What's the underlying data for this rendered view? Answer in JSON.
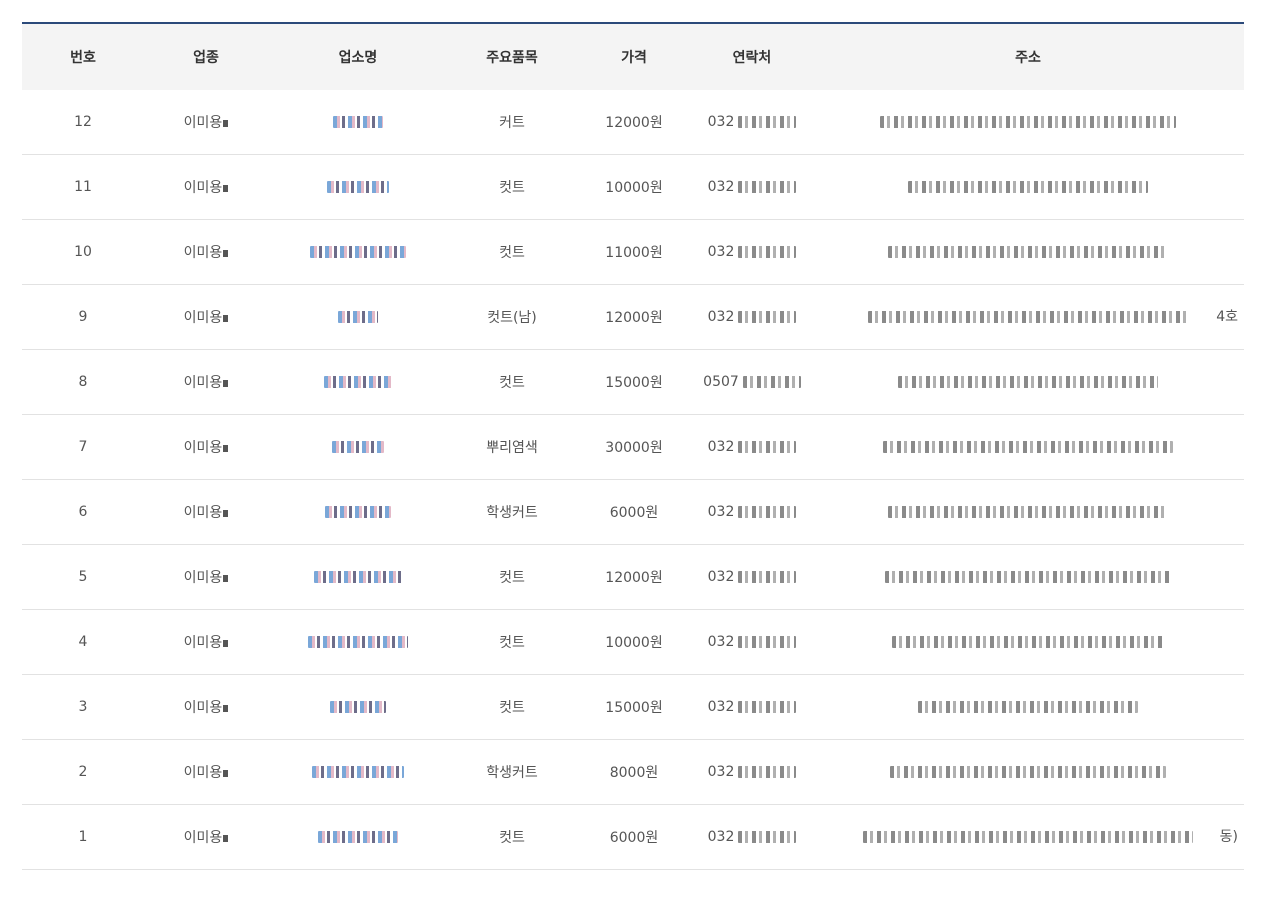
{
  "table": {
    "headers": [
      "번호",
      "업종",
      "업소명",
      "주요품목",
      "가격",
      "연락처",
      "주소"
    ],
    "rows": [
      {
        "num": "12",
        "type": "이미용",
        "item": "커트",
        "price": "12000원",
        "tel": "032",
        "addr_tail": ""
      },
      {
        "num": "11",
        "type": "이미용",
        "item": "컷트",
        "price": "10000원",
        "tel": "032",
        "addr_tail": ""
      },
      {
        "num": "10",
        "type": "이미용",
        "item": "컷트",
        "price": "11000원",
        "tel": "032",
        "addr_tail": ""
      },
      {
        "num": "9",
        "type": "이미용",
        "item": "컷트(남)",
        "price": "12000원",
        "tel": "032",
        "addr_tail": "4호"
      },
      {
        "num": "8",
        "type": "이미용",
        "item": "컷트",
        "price": "15000원",
        "tel": "0507",
        "addr_tail": ""
      },
      {
        "num": "7",
        "type": "이미용",
        "item": "뿌리염색",
        "price": "30000원",
        "tel": "032",
        "addr_tail": ""
      },
      {
        "num": "6",
        "type": "이미용",
        "item": "학생커트",
        "price": "6000원",
        "tel": "032",
        "addr_tail": ""
      },
      {
        "num": "5",
        "type": "이미용",
        "item": "컷트",
        "price": "12000원",
        "tel": "032",
        "addr_tail": ""
      },
      {
        "num": "4",
        "type": "이미용",
        "item": "컷트",
        "price": "10000원",
        "tel": "032",
        "addr_tail": ""
      },
      {
        "num": "3",
        "type": "이미용",
        "item": "컷트",
        "price": "15000원",
        "tel": "032",
        "addr_tail": ""
      },
      {
        "num": "2",
        "type": "이미용",
        "item": "학생커트",
        "price": "8000원",
        "tel": "032",
        "addr_tail": ""
      },
      {
        "num": "1",
        "type": "이미용",
        "item": "컷트",
        "price": "6000원",
        "tel": "032",
        "addr_tail": "동)"
      }
    ]
  },
  "colors": {
    "header_top_border": "#2b4a7a",
    "header_bg": "#f4f4f4",
    "row_border": "#e2e2e2"
  }
}
